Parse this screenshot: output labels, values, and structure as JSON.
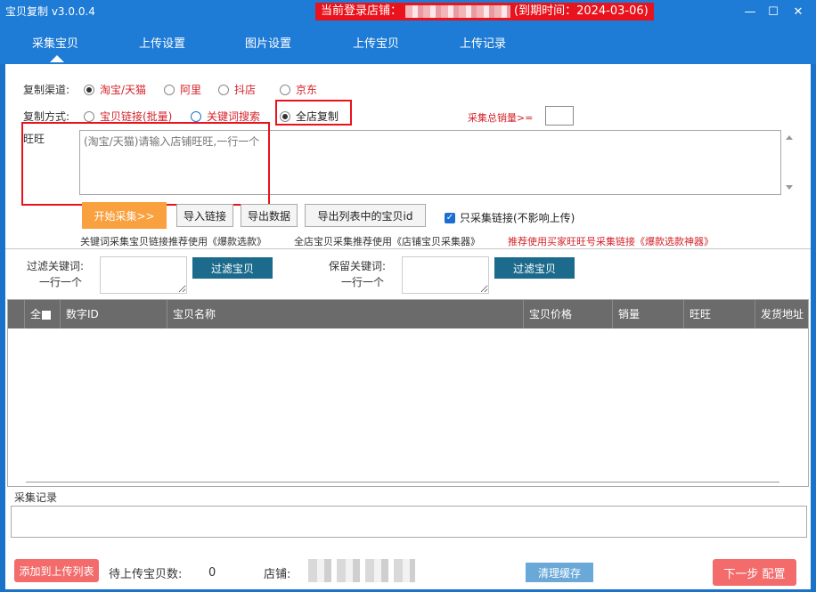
{
  "window": {
    "app_title": "宝贝复制 v3.0.0.4",
    "login_prefix": "当前登录店铺：",
    "expiry_text": "(到期时间：2024-03-06)",
    "minimize": "—",
    "maximize": "☐",
    "close": "✕"
  },
  "nav": {
    "tabs": [
      "采集宝贝",
      "上传设置",
      "图片设置",
      "上传宝贝",
      "上传记录"
    ],
    "active": 0
  },
  "form": {
    "channel_label": "复制渠道:",
    "channels": [
      "淘宝/天猫",
      "阿里",
      "抖店",
      "京东"
    ],
    "channel_selected": "淘宝/天猫",
    "mode_label": "复制方式:",
    "modes": [
      "宝贝链接(批量)",
      "关键词搜索",
      "全店复制"
    ],
    "mode_selected": "全店复制",
    "sales_label": "采集总销量>=",
    "sales_value": "",
    "wangwang_label": "旺旺",
    "wangwang_placeholder": "(淘宝/天猫)请输入店铺旺旺,一行一个"
  },
  "actions": {
    "start": "开始采集>>",
    "import_links": "导入链接",
    "export_data": "导出数据",
    "export_ids": "导出列表中的宝贝id",
    "only_links": "只采集链接(不影响上传)",
    "only_links_checked": true
  },
  "tips": {
    "tip1": "关键词采集宝贝链接推荐使用《爆款选款》",
    "tip2": "全店宝贝采集推荐使用《店铺宝贝采集器》",
    "tip3": "推荐使用买家旺旺号采集链接《爆款选款神器》"
  },
  "filter": {
    "filter_label_1": "过滤关键词:",
    "filter_label_2": "一行一个",
    "filter_button": "过滤宝贝",
    "keep_label_1": "保留关键词:",
    "keep_label_2": "一行一个",
    "keep_button": "过滤宝贝"
  },
  "table": {
    "columns": [
      "全",
      "数字ID",
      "宝贝名称",
      "宝贝价格",
      "销量",
      "旺旺",
      "发货地址"
    ],
    "rows": []
  },
  "log": {
    "label": "采集记录"
  },
  "footer": {
    "add_to_upload": "添加到上传列表",
    "pending_label": "待上传宝贝数:",
    "pending_count": "0",
    "shop_label": "店铺:",
    "clear_cache": "清理缓存",
    "next_step": "下一步 配置"
  }
}
